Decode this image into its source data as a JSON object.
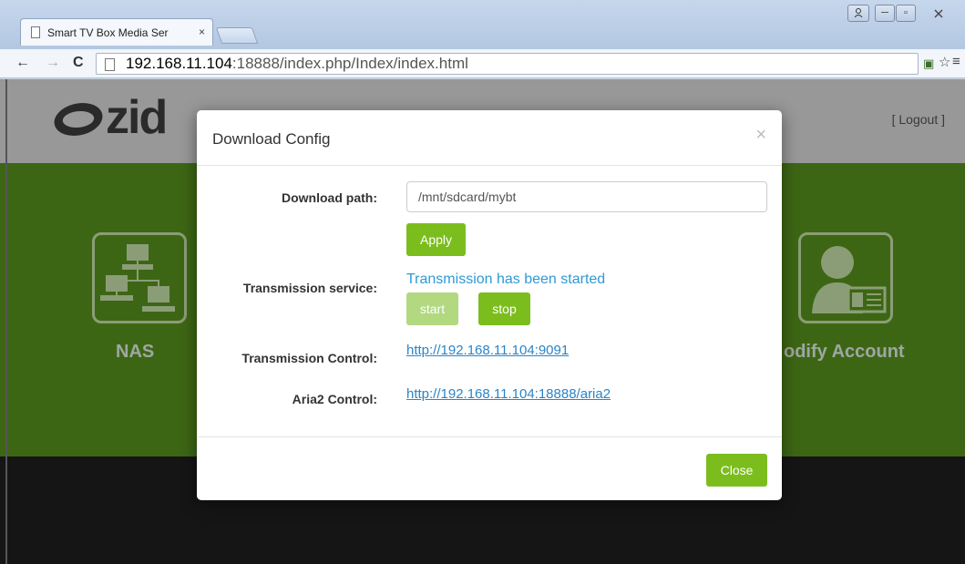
{
  "browser": {
    "tab_title": "Smart TV Box Media Ser",
    "tab_close": "×",
    "url_host": "192.168.11.104",
    "url_rest": ":18888/index.php/Index/index.html",
    "window_controls": {
      "user": "8",
      "minimize": "─",
      "maximize": "▫",
      "close": "☒"
    }
  },
  "page": {
    "logo_text": "zid",
    "logout_label": "[ Logout ]",
    "tiles": [
      {
        "label": "NAS",
        "icon": "network-computers-icon"
      },
      {
        "label": "odify Account",
        "icon": "user-account-icon"
      }
    ]
  },
  "modal": {
    "title": "Download Config",
    "close_x": "×",
    "download_path_label": "Download path:",
    "download_path_value": "/mnt/sdcard/mybt",
    "apply_label": "Apply",
    "transmission_service_label": "Transmission service:",
    "transmission_status": "Transmission has been started",
    "start_label": "start",
    "stop_label": "stop",
    "transmission_control_label": "Transmission Control:",
    "transmission_control_url": "http://192.168.11.104:9091",
    "aria2_control_label": "Aria2 Control:",
    "aria2_control_url": "http://192.168.11.104:18888/aria2",
    "close_label": "Close"
  },
  "colors": {
    "accent_green": "#7cbd1e",
    "disabled_green": "#b2d880",
    "link_blue": "#2a85c8",
    "status_blue": "#2e9ad6"
  }
}
